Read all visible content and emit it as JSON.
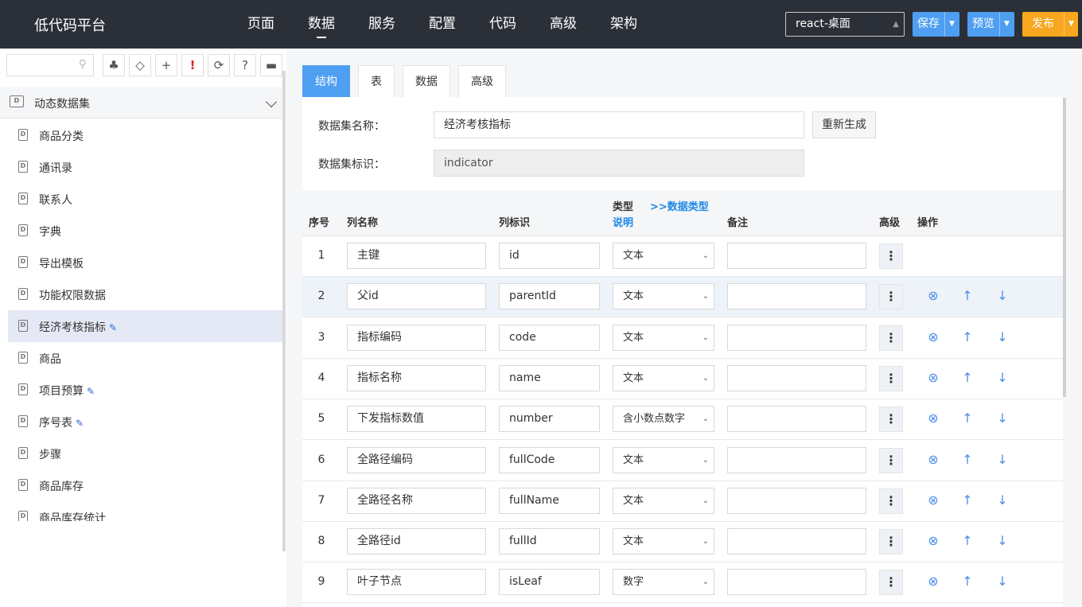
{
  "header": {
    "app_title": "低代码平台",
    "nav": [
      "页面",
      "数据",
      "服务",
      "配置",
      "代码",
      "高级",
      "架构"
    ],
    "active_nav": 1,
    "platform": "react-桌面",
    "save_label": "保存",
    "preview_label": "预览",
    "publish_label": "发布"
  },
  "sidebar": {
    "search_placeholder": "",
    "tools": [
      {
        "name": "tree-icon",
        "glyph": "♣"
      },
      {
        "name": "tag-icon",
        "glyph": "◇"
      },
      {
        "name": "add-icon",
        "glyph": "+"
      },
      {
        "name": "warning-icon",
        "glyph": "!"
      },
      {
        "name": "refresh-icon",
        "glyph": "⟳"
      },
      {
        "name": "help-icon",
        "glyph": "?"
      },
      {
        "name": "comment-icon",
        "glyph": "▬"
      }
    ],
    "group_label": "动态数据集",
    "items": [
      {
        "label": "商品分类",
        "edited": false
      },
      {
        "label": "通讯录",
        "edited": false
      },
      {
        "label": "联系人",
        "edited": false
      },
      {
        "label": "字典",
        "edited": false
      },
      {
        "label": "导出模板",
        "edited": false
      },
      {
        "label": "功能权限数据",
        "edited": false
      },
      {
        "label": "经济考核指标",
        "edited": true,
        "active": true
      },
      {
        "label": "商品",
        "edited": false
      },
      {
        "label": "项目预算",
        "edited": true
      },
      {
        "label": "序号表",
        "edited": true
      },
      {
        "label": "步骤",
        "edited": false
      },
      {
        "label": "商品库存",
        "edited": false
      },
      {
        "label": "商品库存统计",
        "edited": false
      }
    ]
  },
  "main": {
    "tabs": [
      "结构",
      "表",
      "数据",
      "高级"
    ],
    "active_tab": 0,
    "dataset_name_label": "数据集名称：",
    "dataset_name_value": "经济考核指标",
    "regenerate_label": "重新生成",
    "dataset_id_label": "数据集标识：",
    "dataset_id_value": "indicator",
    "columns": {
      "index": "序号",
      "name": "列名称",
      "ident": "列标识",
      "type_line1": "类型",
      "type_link": ">>数据类型",
      "type_line2": "说明",
      "note": "备注",
      "advanced": "高级",
      "actions": "操作"
    },
    "rows": [
      {
        "index": "1",
        "name": "主键",
        "ident": "id",
        "type": "文本",
        "note": "",
        "actions": false
      },
      {
        "index": "2",
        "name": "父id",
        "ident": "parentId",
        "type": "文本",
        "note": "",
        "actions": true
      },
      {
        "index": "3",
        "name": "指标编码",
        "ident": "code",
        "type": "文本",
        "note": "",
        "actions": true
      },
      {
        "index": "4",
        "name": "指标名称",
        "ident": "name",
        "type": "文本",
        "note": "",
        "actions": true
      },
      {
        "index": "5",
        "name": "下发指标数值",
        "ident": "number",
        "type": "含小数点数字",
        "note": "",
        "actions": true
      },
      {
        "index": "6",
        "name": "全路径编码",
        "ident": "fullCode",
        "type": "文本",
        "note": "",
        "actions": true
      },
      {
        "index": "7",
        "name": "全路径名称",
        "ident": "fullName",
        "type": "文本",
        "note": "",
        "actions": true
      },
      {
        "index": "8",
        "name": "全路径id",
        "ident": "fullId",
        "type": "文本",
        "note": "",
        "actions": true
      },
      {
        "index": "9",
        "name": "叶子节点",
        "ident": "isLeaf",
        "type": "数字",
        "note": "",
        "actions": true
      }
    ]
  }
}
